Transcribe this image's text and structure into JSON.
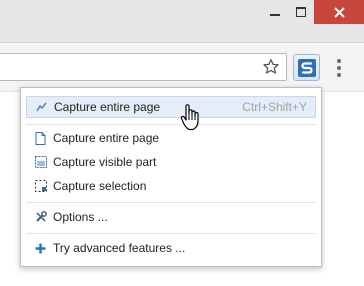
{
  "window": {
    "minimize_icon": "minimize-icon",
    "maximize_icon": "maximize-icon",
    "close_icon": "close-icon",
    "close_color": "#c7453a"
  },
  "toolbar": {
    "bookmark_icon": "star-icon",
    "extension_icon": "extension-s-icon",
    "menu_icon": "kebab-menu-icon"
  },
  "menu": {
    "top_item": {
      "label": "Capture entire page",
      "shortcut": "Ctrl+Shift+Y",
      "icon": "scroll-capture-icon"
    },
    "items": [
      {
        "label": "Capture entire page",
        "icon": "page-icon"
      },
      {
        "label": "Capture visible part",
        "icon": "visible-part-icon"
      },
      {
        "label": "Capture selection",
        "icon": "selection-icon"
      }
    ],
    "options": {
      "label": "Options ...",
      "icon": "tools-icon"
    },
    "advanced": {
      "label": "Try advanced features ...",
      "icon": "plus-icon"
    }
  }
}
